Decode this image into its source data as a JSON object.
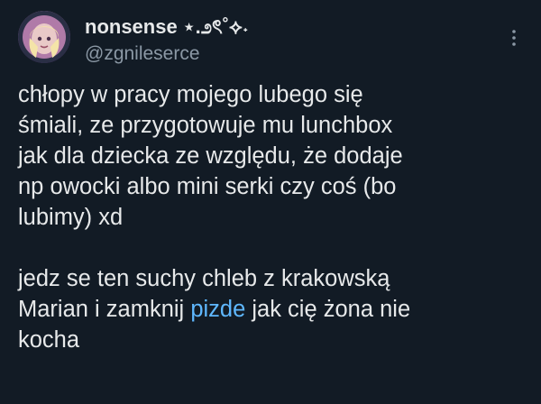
{
  "tweet": {
    "author": {
      "display_name": "nonsense ⋆.೨ৎ˚⟡˖",
      "handle": "@zgnileserce",
      "avatar": "avatar"
    },
    "more_icon": "more-vertical-icon",
    "body": {
      "paragraph1": [
        "chłopy w pracy mojego lubego się",
        "śmiali, ze przygotowuje mu lunchbox",
        "jak dla dziecka ze względu, że dodaje",
        "np owocki albo mini serki czy coś (bo",
        "lubimy) xd"
      ],
      "paragraph2": {
        "line1": "jedz se ten suchy chleb z krakowską",
        "line2_before": "Marian i zamknij ",
        "line2_highlight": "pizde",
        "line2_after": " jak cię żona nie",
        "line3": "kocha"
      }
    },
    "colors": {
      "background": "#121b25",
      "text": "#e7e9ea",
      "secondary_text": "#8b98a5",
      "highlight": "#5fb8ff"
    }
  }
}
